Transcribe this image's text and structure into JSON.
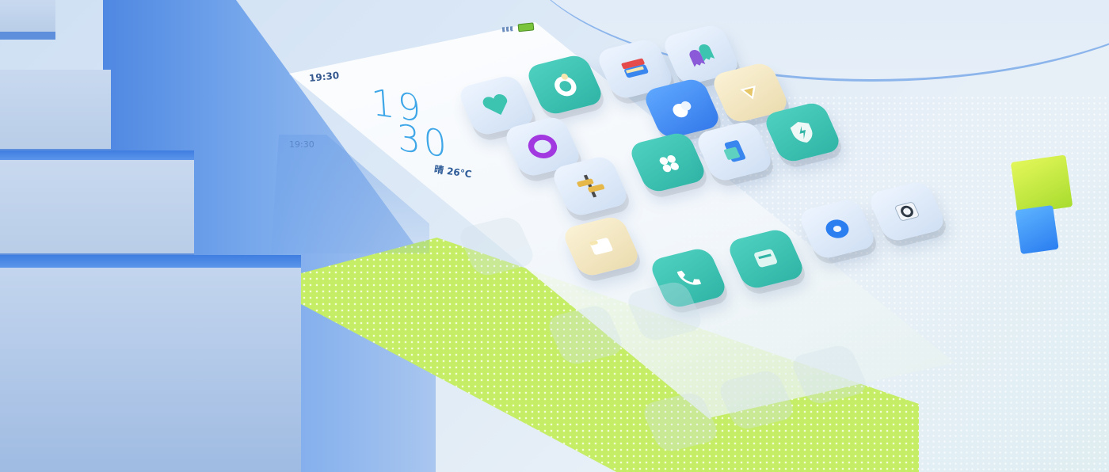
{
  "status_bar": {
    "time": "19:30"
  },
  "clock_widget": {
    "hour": "19",
    "minute": "30",
    "weather": "晴 26°C"
  },
  "ghost_widget": {
    "time": "19:30"
  },
  "icons": [
    {
      "name": "heart-app-icon",
      "glyph": "heart-icon",
      "color": "#4fd1c0"
    },
    {
      "name": "ring-app-icon",
      "glyph": "ring-icon",
      "color": "#4fd1c0"
    },
    {
      "name": "torus-app-icon",
      "glyph": "torus-icon",
      "color": "#b23be6"
    },
    {
      "name": "wallet-app-icon",
      "glyph": "wallet-icon",
      "color": "#e54b4b"
    },
    {
      "name": "ghosts-app-icon",
      "glyph": "ghost-icon",
      "color": "#8a5ad8"
    },
    {
      "name": "weather-app-icon",
      "glyph": "cloud-icon",
      "color": "#3479ea"
    },
    {
      "name": "tag-app-icon",
      "glyph": "tag-icon",
      "color": "#e6c566"
    },
    {
      "name": "signpost-app-icon",
      "glyph": "signpost-icon",
      "color": "#e6b84a"
    },
    {
      "name": "flower-app-icon",
      "glyph": "flower-icon",
      "color": "#2fb4a5"
    },
    {
      "name": "transfer-app-icon",
      "glyph": "transfer-icon",
      "color": "#3479ea"
    },
    {
      "name": "shield-app-icon",
      "glyph": "shield-icon",
      "color": "#2fb4a5"
    },
    {
      "name": "folder-app-icon",
      "glyph": "folder-icon",
      "color": "#e6c566"
    },
    {
      "name": "phone-app-icon",
      "glyph": "phone-icon",
      "color": "#2fb4a5"
    },
    {
      "name": "messages-app-icon",
      "glyph": "message-icon",
      "color": "#2fb4a5"
    },
    {
      "name": "browser-app-icon",
      "glyph": "donut-icon",
      "color": "#2b7ef0"
    },
    {
      "name": "camera-app-icon",
      "glyph": "camera-icon",
      "color": "#3a4a5a"
    }
  ]
}
